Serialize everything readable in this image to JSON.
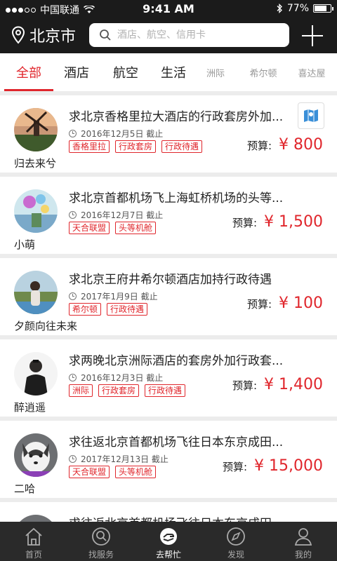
{
  "status_bar": {
    "carrier": "中国联通",
    "time": "9:41 AM",
    "battery_pct": "77%",
    "battery_level": 0.77,
    "signal_bars": 3
  },
  "nav": {
    "city": "北京市",
    "search_placeholder": "酒店、航空、信用卡"
  },
  "tabs": [
    {
      "label": "全部",
      "active": true
    },
    {
      "label": "酒店"
    },
    {
      "label": "航空"
    },
    {
      "label": "生活"
    },
    {
      "label": "洲际"
    },
    {
      "label": "希尔顿"
    },
    {
      "label": "喜达屋"
    }
  ],
  "cards": [
    {
      "user": "归去来兮",
      "title": "求北京香格里拉大酒店的行政套房外加...",
      "date": "2016年12月5日 截止",
      "tags": [
        "香格里拉",
        "行政套房",
        "行政待遇"
      ],
      "budget_label": "预算:",
      "price": "¥ 800"
    },
    {
      "user": "小萌",
      "title": "求北京首都机场飞上海虹桥机场的头等...",
      "date": "2016年12月7日 截止",
      "tags": [
        "天合联盟",
        "头等机舱"
      ],
      "budget_label": "预算:",
      "price": "¥ 1,500"
    },
    {
      "user": "夕颜向往未来",
      "title": "求北京王府井希尔顿酒店加持行政待遇",
      "date": "2017年1月9日 截止",
      "tags": [
        "希尔顿",
        "行政待遇"
      ],
      "budget_label": "预算:",
      "price": "¥ 100"
    },
    {
      "user": "醉逍遥",
      "title": "求两晚北京洲际酒店的套房外加行政套...",
      "date": "2016年12月3日 截止",
      "tags": [
        "洲际",
        "行政套房",
        "行政待遇"
      ],
      "budget_label": "预算:",
      "price": "¥ 1,400"
    },
    {
      "user": "二哈",
      "title": "求往返北京首都机场飞往日本东京成田...",
      "date": "2017年12月13日 截止",
      "tags": [
        "天合联盟",
        "头等机舱"
      ],
      "budget_label": "预算:",
      "price": "¥ 15,000"
    },
    {
      "user": "",
      "title": "求往返北京首都机场飞往日本东京成田",
      "date": "",
      "tags": [],
      "budget_label": "",
      "price": ""
    }
  ],
  "tabbar": [
    {
      "label": "首页",
      "icon": "home-icon"
    },
    {
      "label": "找服务",
      "icon": "search-service-icon"
    },
    {
      "label": "去帮忙",
      "icon": "help-hand-icon",
      "active": true
    },
    {
      "label": "发现",
      "icon": "compass-icon"
    },
    {
      "label": "我的",
      "icon": "profile-icon"
    }
  ],
  "colors": {
    "accent": "#e0262c",
    "header_bg": "#1b1b1b",
    "tabbar_bg": "#2a2a2a"
  }
}
